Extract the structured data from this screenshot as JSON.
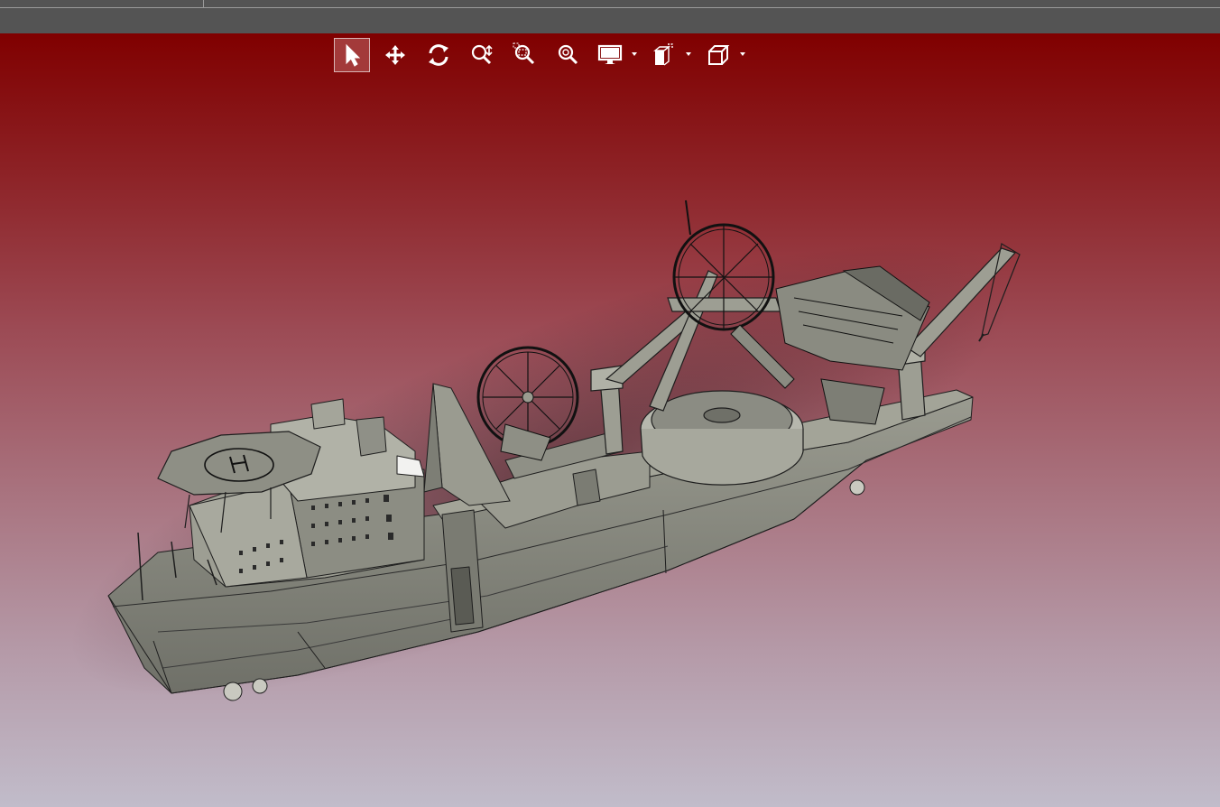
{
  "window": {
    "tabs": []
  },
  "toolbar": {
    "tools": [
      {
        "name": "select-icon",
        "active": true,
        "dropdown": false
      },
      {
        "name": "pan-icon",
        "active": false,
        "dropdown": false
      },
      {
        "name": "rotate-icon",
        "active": false,
        "dropdown": false
      },
      {
        "name": "zoom-icon",
        "active": false,
        "dropdown": false
      },
      {
        "name": "zoom-window-icon",
        "active": false,
        "dropdown": false
      },
      {
        "name": "zoom-fit-icon",
        "active": false,
        "dropdown": false
      },
      {
        "name": "display-mode-icon",
        "active": false,
        "dropdown": true
      },
      {
        "name": "view-orientation-icon",
        "active": false,
        "dropdown": true
      },
      {
        "name": "standard-view-icon",
        "active": false,
        "dropdown": true
      }
    ]
  },
  "viewport": {
    "background_top": "#800000",
    "background_bottom": "#c1bcca",
    "model": "3d-ship-model"
  },
  "colors": {
    "toolbar_active": "#a33a3a",
    "hull": "#8a8b80",
    "edge": "#1e1e1e"
  }
}
